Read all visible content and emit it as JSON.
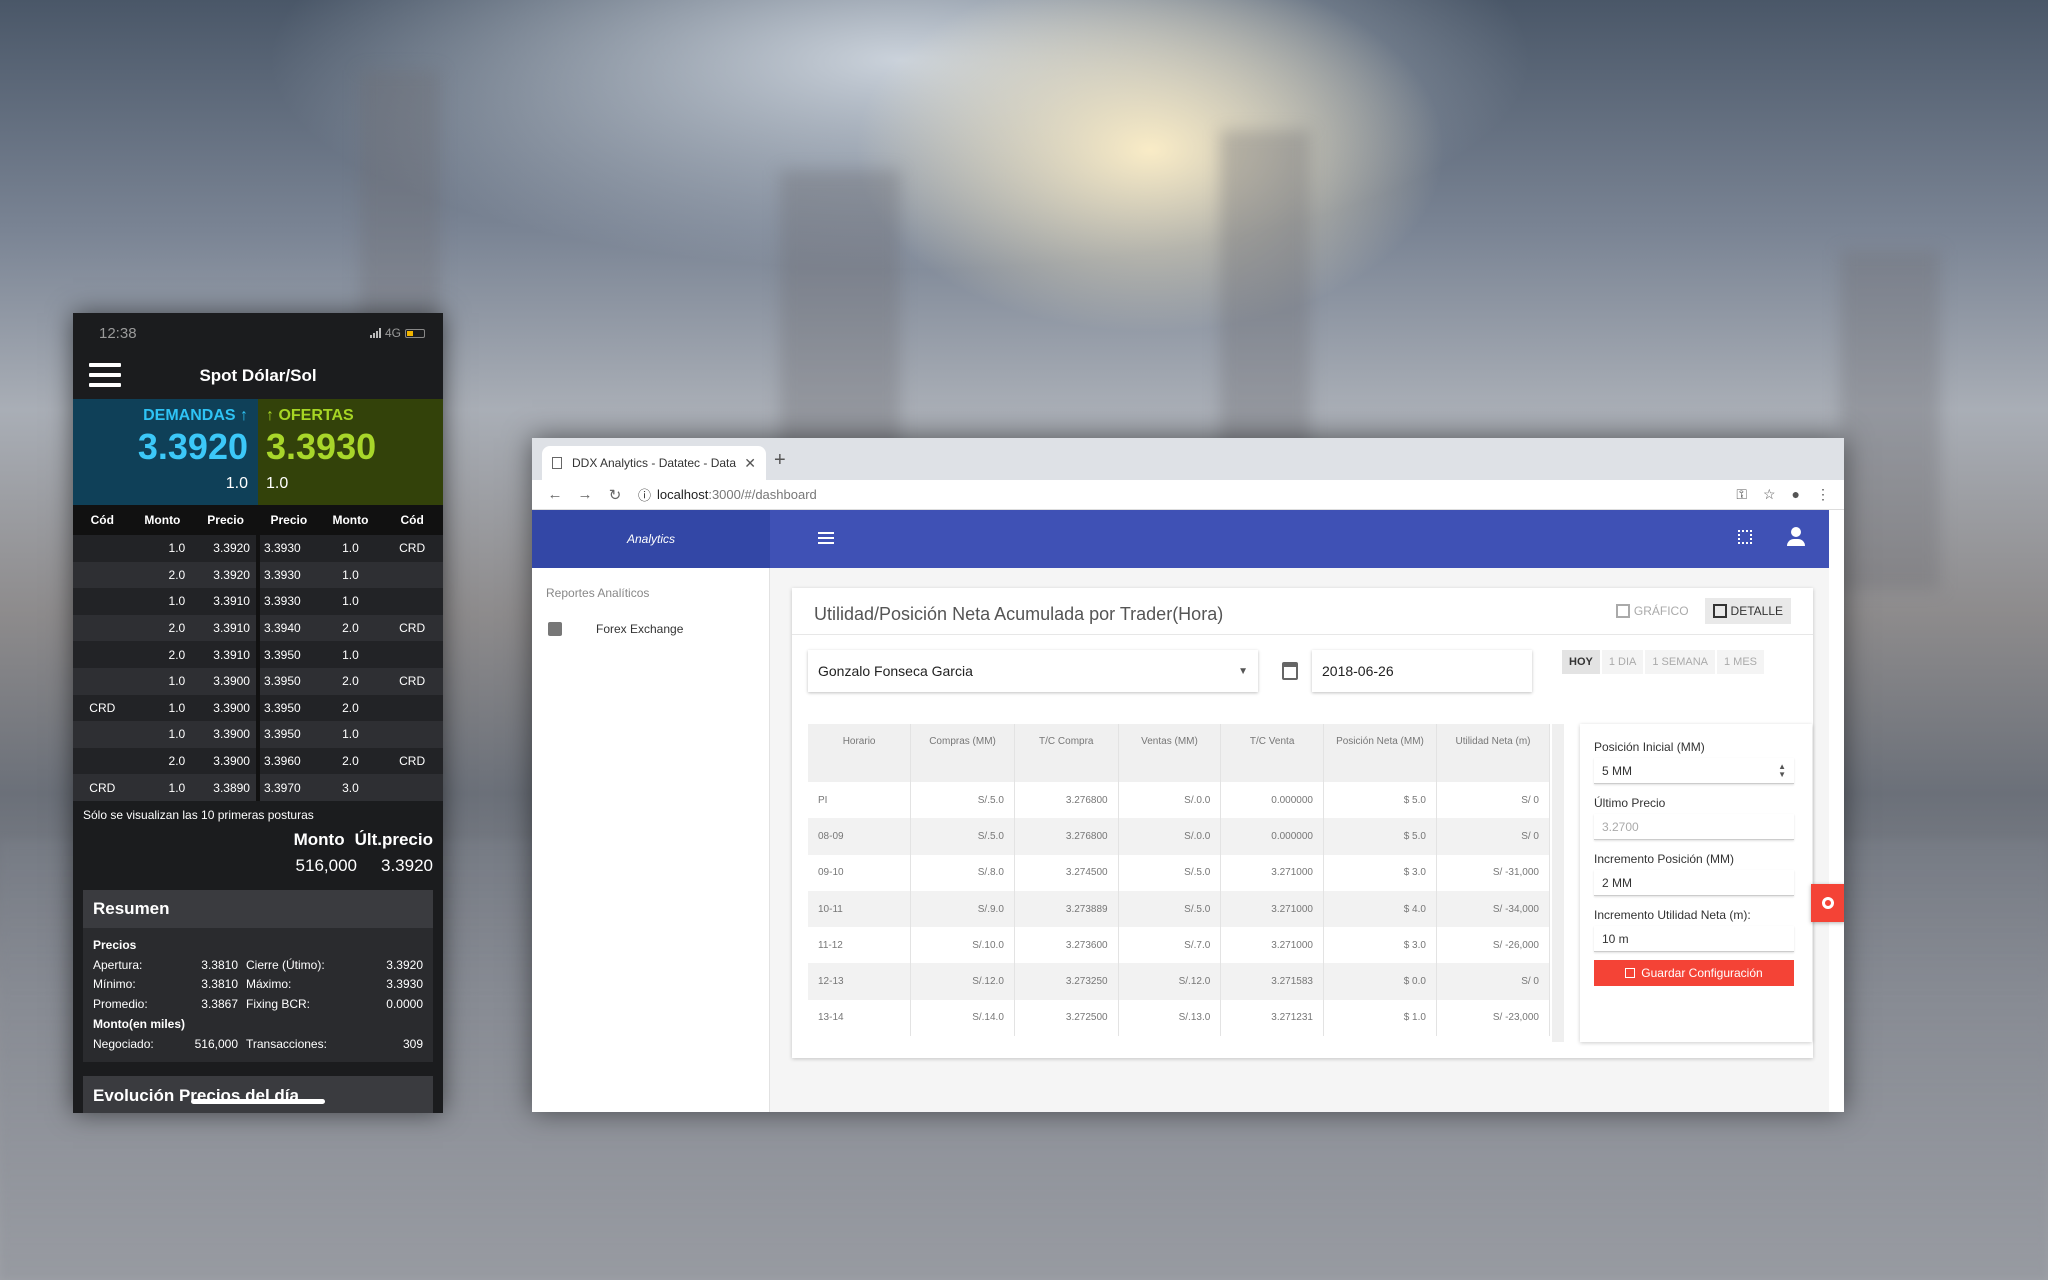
{
  "phone": {
    "status": {
      "time": "12:38",
      "network": "4G"
    },
    "title": "Spot Dólar/Sol",
    "demand": {
      "label": "DEMANDAS ↑",
      "price": "3.3920",
      "qty": "1.0"
    },
    "offer": {
      "label": "↑ OFERTAS",
      "price": "3.3930",
      "qty": "1.0"
    },
    "book_headers": [
      "Cód",
      "Monto",
      "Precio",
      "Precio",
      "Monto",
      "Cód"
    ],
    "book_rows": [
      [
        "",
        "1.0",
        "3.3920",
        "3.3930",
        "1.0",
        "CRD"
      ],
      [
        "",
        "2.0",
        "3.3920",
        "3.3930",
        "1.0",
        ""
      ],
      [
        "",
        "1.0",
        "3.3910",
        "3.3930",
        "1.0",
        ""
      ],
      [
        "",
        "2.0",
        "3.3910",
        "3.3940",
        "2.0",
        "CRD"
      ],
      [
        "",
        "2.0",
        "3.3910",
        "3.3950",
        "1.0",
        ""
      ],
      [
        "",
        "1.0",
        "3.3900",
        "3.3950",
        "2.0",
        "CRD"
      ],
      [
        "CRD",
        "1.0",
        "3.3900",
        "3.3950",
        "2.0",
        ""
      ],
      [
        "",
        "1.0",
        "3.3900",
        "3.3950",
        "1.0",
        ""
      ],
      [
        "",
        "2.0",
        "3.3900",
        "3.3960",
        "2.0",
        "CRD"
      ],
      [
        "CRD",
        "1.0",
        "3.3890",
        "3.3970",
        "3.0",
        ""
      ]
    ],
    "book_note": "Sólo se visualizan las 10 primeras posturas",
    "monto_label": "Monto",
    "ult_label": "Últ.precio",
    "monto_value": "516,000",
    "ult_value": "3.3920",
    "resumen": {
      "title": "Resumen",
      "precios_label": "Precios",
      "rows": [
        {
          "l1": "Apertura:",
          "v1": "3.3810",
          "l2": "Cierre (Útimo):",
          "v2": "3.3920"
        },
        {
          "l1": "Mínimo:",
          "v1": "3.3810",
          "l2": "Máximo:",
          "v2": "3.3930"
        },
        {
          "l1": "Promedio:",
          "v1": "3.3867",
          "l2": "Fixing BCR:",
          "v2": "0.0000"
        }
      ],
      "monto_label": "Monto(en miles)",
      "monto_row": {
        "l1": "Negociado:",
        "v1": "516,000",
        "l2": "Transacciones:",
        "v2": "309"
      }
    },
    "evolucion_title": "Evolución Precios del día"
  },
  "browser": {
    "tab_title": "DDX Analytics - Datatec - Data",
    "url_host": "localhost",
    "url_path": ":3000/#/dashboard",
    "brand": "Analytics",
    "sidebar": {
      "heading": "Reportes Analíticos",
      "item": "Forex Exchange"
    },
    "card_title": "Utilidad/Posición Neta Acumulada por Trader(Hora)",
    "view_grafico": "GRÁFICO",
    "view_detalle": "DETALLE",
    "trader": "Gonzalo Fonseca Garcia",
    "date": "2018-06-26",
    "ranges": [
      "HOY",
      "1 DIA",
      "1 SEMANA",
      "1 MES"
    ],
    "grid_headers": [
      "Horario",
      "Compras (MM)",
      "T/C Compra",
      "Ventas (MM)",
      "T/C Venta",
      "Posición Neta (MM)",
      "Utilidad Neta (m)"
    ],
    "grid_rows": [
      [
        "PI",
        "S/.5.0",
        "3.276800",
        "S/.0.0",
        "0.000000",
        "$ 5.0",
        "S/ 0"
      ],
      [
        "08-09",
        "S/.5.0",
        "3.276800",
        "S/.0.0",
        "0.000000",
        "$ 5.0",
        "S/ 0"
      ],
      [
        "09-10",
        "S/.8.0",
        "3.274500",
        "S/.5.0",
        "3.271000",
        "$ 3.0",
        "S/ -31,000"
      ],
      [
        "10-11",
        "S/.9.0",
        "3.273889",
        "S/.5.0",
        "3.271000",
        "$ 4.0",
        "S/ -34,000"
      ],
      [
        "11-12",
        "S/.10.0",
        "3.273600",
        "S/.7.0",
        "3.271000",
        "$ 3.0",
        "S/ -26,000"
      ],
      [
        "12-13",
        "S/.12.0",
        "3.273250",
        "S/.12.0",
        "3.271583",
        "$ 0.0",
        "S/ 0"
      ],
      [
        "13-14",
        "S/.14.0",
        "3.272500",
        "S/.13.0",
        "3.271231",
        "$ 1.0",
        "S/ -23,000"
      ]
    ],
    "config": {
      "pos_inicial_label": "Posición Inicial (MM)",
      "pos_inicial_value": "5 MM",
      "ultimo_precio_label": "Último Precio",
      "ultimo_precio_value": "3.2700",
      "inc_pos_label": "Incremento Posición (MM)",
      "inc_pos_value": "2 MM",
      "inc_util_label": "Incremento Utilidad Neta (m):",
      "inc_util_value": "10 m",
      "save_label": "Guardar Configuración"
    }
  }
}
